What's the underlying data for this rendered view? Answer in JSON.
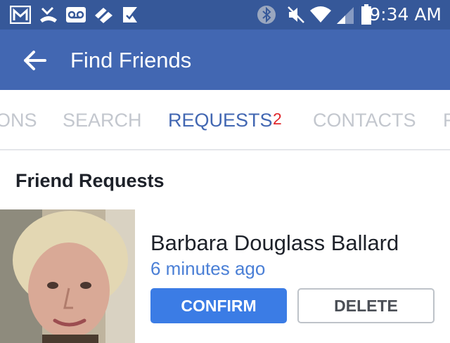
{
  "status_bar": {
    "time": "9:34 AM",
    "icons": [
      "gmail-icon",
      "missed-call-icon",
      "voicemail-icon",
      "do-not-disturb-icon",
      "app-check-icon",
      "bluetooth-icon",
      "mute-icon",
      "wifi-icon",
      "signal-icon",
      "battery-icon"
    ]
  },
  "header": {
    "title": "Find Friends",
    "back_icon": "arrow-back-icon"
  },
  "tabs": [
    {
      "label": "ONS"
    },
    {
      "label": "SEARCH"
    },
    {
      "label": "REQUESTS",
      "badge": "2",
      "active": true
    },
    {
      "label": "CONTACTS"
    },
    {
      "label": "F"
    }
  ],
  "main": {
    "section_title": "Friend Requests",
    "requests": [
      {
        "name": "Barbara Douglass Ballard",
        "time": "6 minutes ago",
        "confirm_label": "CONFIRM",
        "delete_label": "DELETE"
      }
    ]
  },
  "colors": {
    "status_bar": "#365899",
    "app_bar": "#4267b2",
    "active_tab": "#4267b2",
    "badge": "#e0262b",
    "confirm": "#3b7ce5",
    "time_link": "#4a7fd6"
  }
}
